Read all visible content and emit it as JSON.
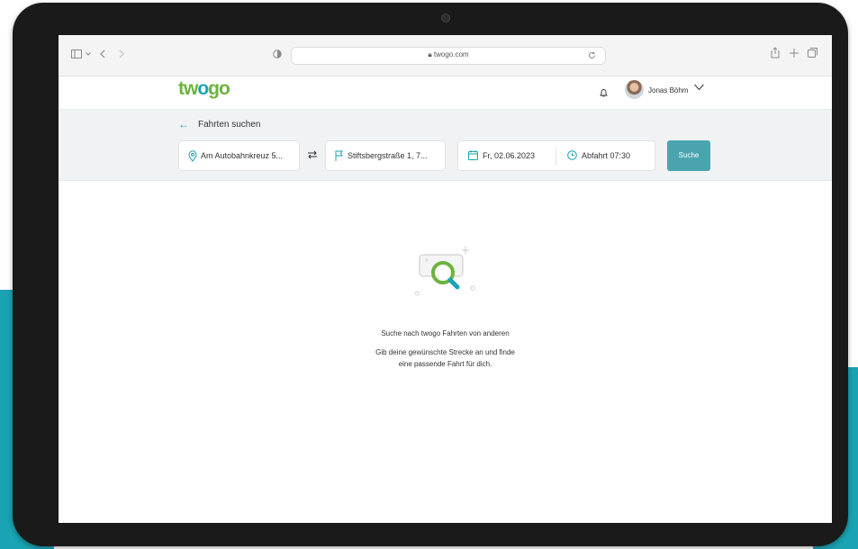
{
  "browser": {
    "url": "twogo.com"
  },
  "app": {
    "logo_part1": "tw",
    "logo_part2": "o",
    "logo_part3": "go",
    "user_name": "Jonas Böhm"
  },
  "search_bar": {
    "back_label": "←",
    "title": "Fahrten suchen",
    "from": "Am Autobahnkreuz 5...",
    "to": "Stiftsbergstraße 1, 7...",
    "date": "Fr, 02.06.2023",
    "time": "Abfahrt 07:30",
    "search_button": "Suche"
  },
  "empty_state": {
    "headline": "Suche nach twogo Fahrten von anderen",
    "line1": "Gib deine gewünschte Strecke an und finde",
    "line2": "eine passende Fahrt für dich."
  },
  "colors": {
    "brand_green": "#6cb33f",
    "brand_teal": "#1aa3b3",
    "button": "#4aa4b0"
  }
}
